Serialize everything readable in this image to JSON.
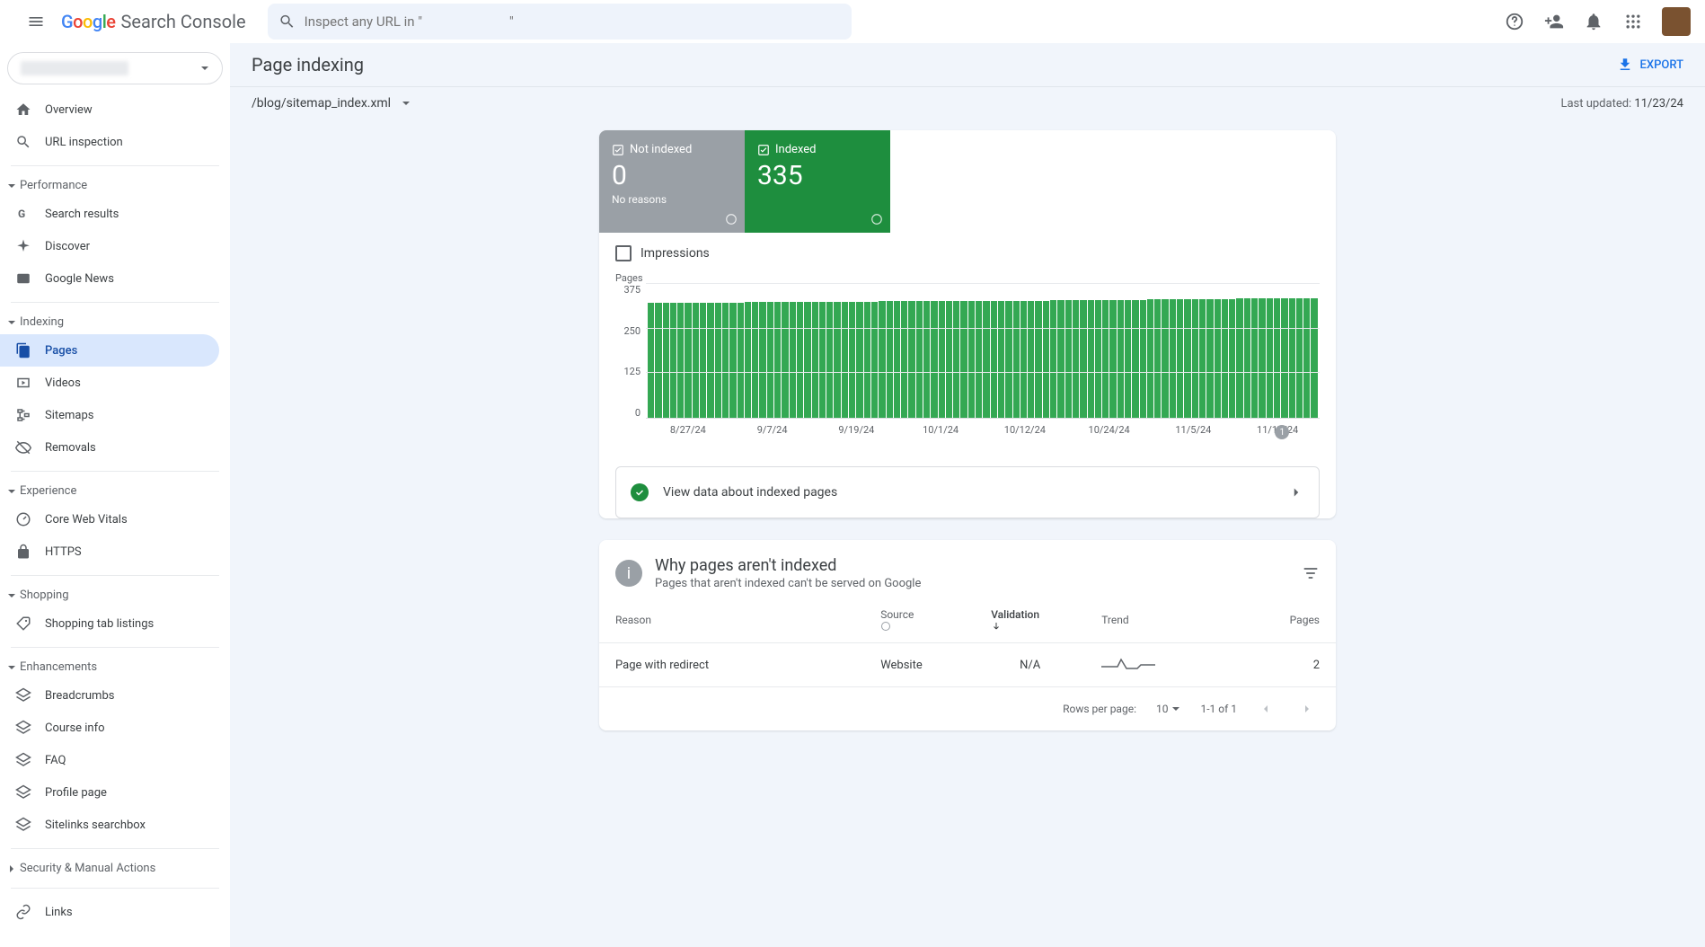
{
  "header": {
    "product_name": "Search Console",
    "search_placeholder": "Inspect any URL in \"                          \""
  },
  "sidebar": {
    "overview": "Overview",
    "url_inspection": "URL inspection",
    "sections": {
      "performance": {
        "label": "Performance",
        "items": [
          "Search results",
          "Discover",
          "Google News"
        ]
      },
      "indexing": {
        "label": "Indexing",
        "items": [
          "Pages",
          "Videos",
          "Sitemaps",
          "Removals"
        ]
      },
      "experience": {
        "label": "Experience",
        "items": [
          "Core Web Vitals",
          "HTTPS"
        ]
      },
      "shopping": {
        "label": "Shopping",
        "items": [
          "Shopping tab listings"
        ]
      },
      "enhancements": {
        "label": "Enhancements",
        "items": [
          "Breadcrumbs",
          "Course info",
          "FAQ",
          "Profile page",
          "Sitelinks searchbox"
        ]
      },
      "security": {
        "label": "Security & Manual Actions"
      },
      "links": {
        "label": "Links"
      }
    }
  },
  "page": {
    "title": "Page indexing",
    "export": "EXPORT",
    "sitemap": "/blog/sitemap_index.xml",
    "last_updated_label": "Last updated: ",
    "last_updated_date": "11/23/24"
  },
  "tiles": {
    "not_indexed": {
      "label": "Not indexed",
      "value": "0",
      "sub": "No reasons"
    },
    "indexed": {
      "label": "Indexed",
      "value": "335"
    }
  },
  "impressions_label": "Impressions",
  "chart_data": {
    "type": "bar",
    "ylabel": "Pages",
    "ylim": [
      0,
      375
    ],
    "yticks": [
      0,
      125,
      250,
      375
    ],
    "xlabels": [
      "8/27/24",
      "9/7/24",
      "9/19/24",
      "10/1/24",
      "10/12/24",
      "10/24/24",
      "11/5/24",
      "11/17/24"
    ],
    "series": [
      {
        "name": "Indexed",
        "color": "#34a853",
        "values": [
          322,
          322,
          322,
          322,
          323,
          323,
          323,
          323,
          323,
          323,
          323,
          323,
          323,
          324,
          324,
          324,
          324,
          324,
          324,
          324,
          324,
          324,
          325,
          325,
          325,
          325,
          325,
          325,
          325,
          325,
          325,
          326,
          326,
          326,
          326,
          326,
          326,
          326,
          327,
          327,
          327,
          327,
          327,
          327,
          327,
          327,
          328,
          328,
          328,
          328,
          328,
          328,
          328,
          328,
          329,
          329,
          329,
          329,
          329,
          329,
          329,
          330,
          330,
          330,
          330,
          330,
          330,
          331,
          331,
          331,
          331,
          332,
          332,
          332,
          332,
          333,
          333,
          333,
          333,
          334,
          334,
          334,
          334,
          334,
          335,
          335,
          335,
          335,
          335,
          335
        ]
      }
    ],
    "annotation": {
      "index": 85,
      "label": "1"
    }
  },
  "view_data": "View data about indexed pages",
  "reasons_card": {
    "title": "Why pages aren't indexed",
    "subtitle": "Pages that aren't indexed can't be served on Google",
    "columns": {
      "reason": "Reason",
      "source": "Source",
      "validation": "Validation",
      "trend": "Trend",
      "pages": "Pages"
    },
    "rows": [
      {
        "reason": "Page with redirect",
        "source": "Website",
        "validation": "N/A",
        "pages": "2"
      }
    ],
    "pager": {
      "rows_label": "Rows per page:",
      "rows_value": "10",
      "range": "1-1 of 1"
    }
  }
}
